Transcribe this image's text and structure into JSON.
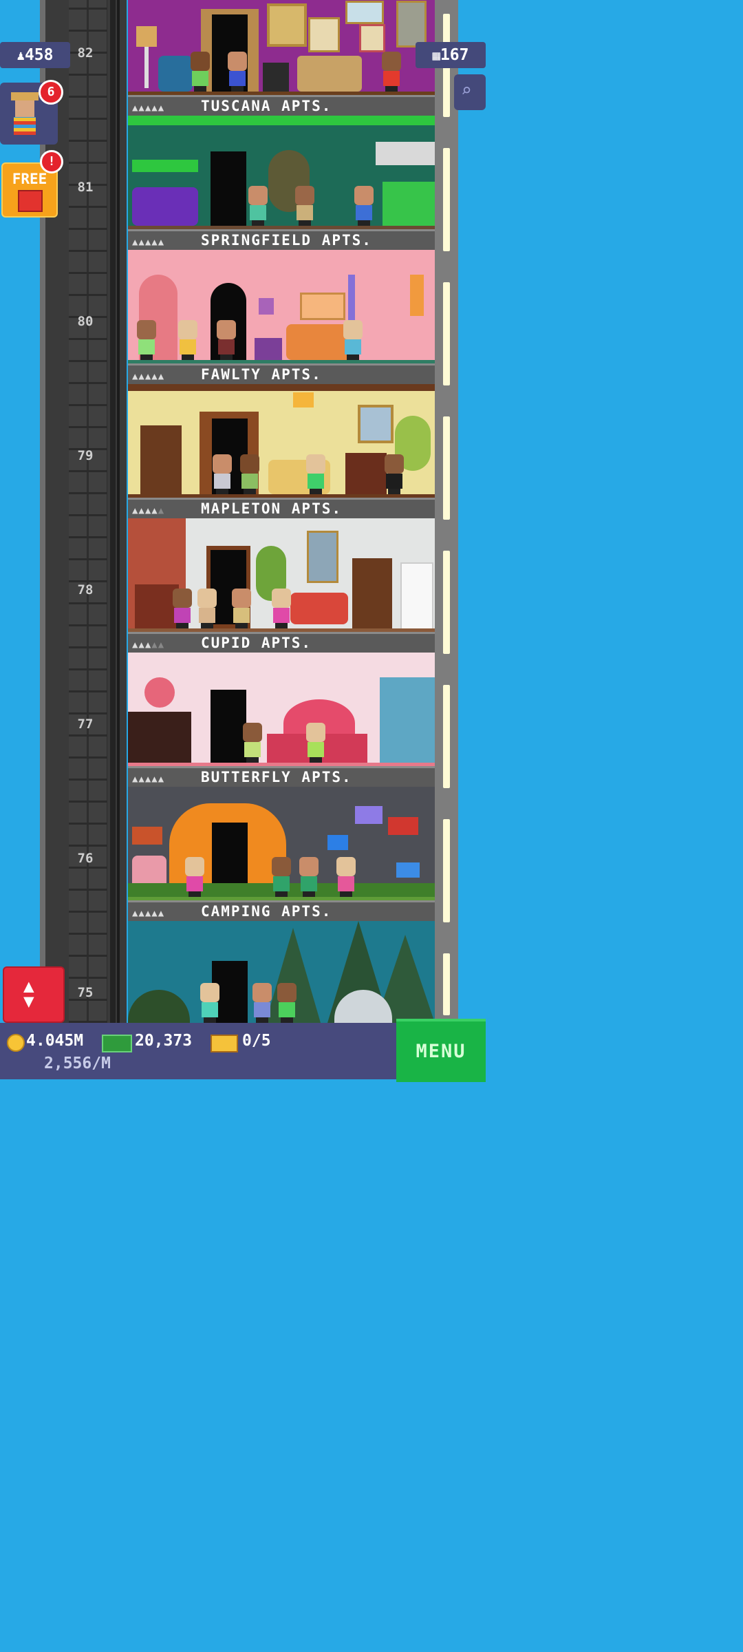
{
  "hud": {
    "population": "458",
    "floor_count": "167",
    "visitor_badge": "6",
    "free_gift_label": "FREE",
    "free_gift_badge": "!"
  },
  "floors": [
    {
      "number": "82",
      "name": "TUSCANA APTS.",
      "stars": 5
    },
    {
      "number": "81",
      "name": "SPRINGFIELD APTS.",
      "stars": 5
    },
    {
      "number": "80",
      "name": "FAWLTY APTS.",
      "stars": 5
    },
    {
      "number": "79",
      "name": "MAPLETON APTS.",
      "stars": 4
    },
    {
      "number": "78",
      "name": "CUPID APTS.",
      "stars": 3
    },
    {
      "number": "77",
      "name": "BUTTERFLY APTS.",
      "stars": 5
    },
    {
      "number": "76",
      "name": "CAMPING APTS.",
      "stars": 5
    },
    {
      "number": "75",
      "name": "",
      "stars": 0
    }
  ],
  "bottom": {
    "coins": "4.045M",
    "income": "2,556/M",
    "bux": "20,373",
    "tickets": "0/5",
    "menu_label": "MENU"
  },
  "colors": {
    "sky": "#27a9e6",
    "menu": "#19b446",
    "badge": "#e4232c",
    "elevator_button": "#e5283b"
  }
}
